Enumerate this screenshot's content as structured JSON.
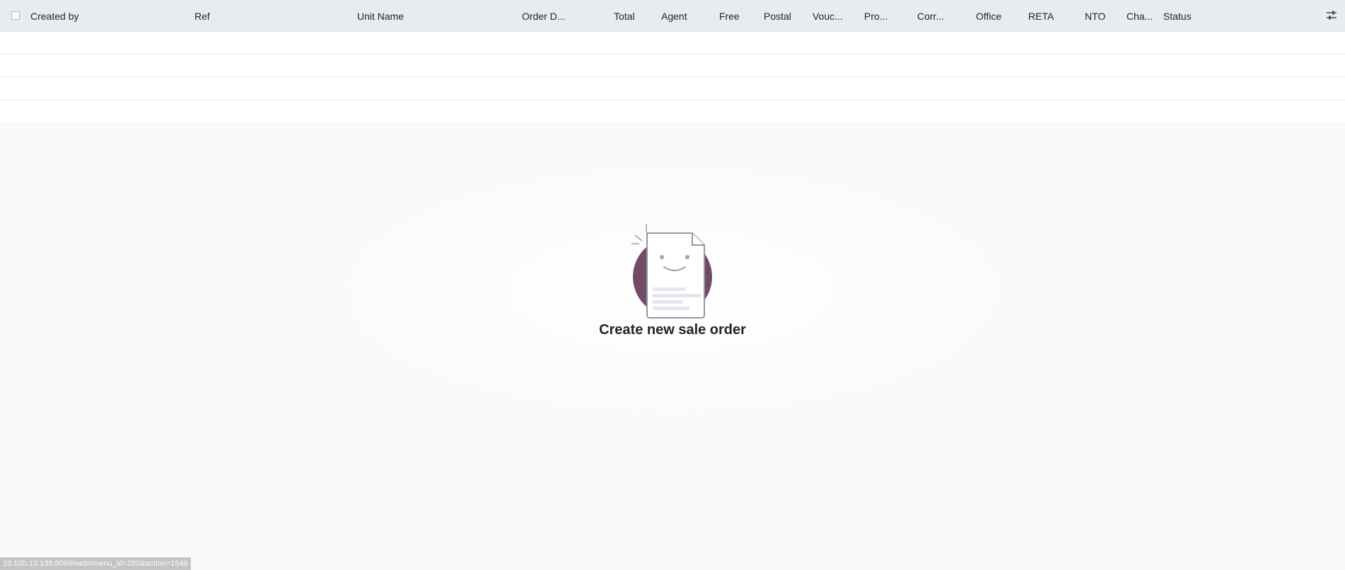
{
  "list": {
    "columns": [
      {
        "key": "created_by",
        "label": "Created by"
      },
      {
        "key": "ref",
        "label": "Ref"
      },
      {
        "key": "unit_name",
        "label": "Unit Name"
      },
      {
        "key": "order_date",
        "label": "Order D..."
      },
      {
        "key": "total",
        "label": "Total"
      },
      {
        "key": "agent",
        "label": "Agent"
      },
      {
        "key": "free",
        "label": "Free"
      },
      {
        "key": "postal",
        "label": "Postal"
      },
      {
        "key": "voucher",
        "label": "Vouc..."
      },
      {
        "key": "pro",
        "label": "Pro..."
      },
      {
        "key": "corr",
        "label": "Corr..."
      },
      {
        "key": "office",
        "label": "Office"
      },
      {
        "key": "reta",
        "label": "RETA"
      },
      {
        "key": "nto",
        "label": "NTO"
      },
      {
        "key": "cha",
        "label": "Cha..."
      },
      {
        "key": "status",
        "label": "Status"
      }
    ],
    "optional_columns_icon": "sliders-icon",
    "select_all_icon": "checkbox-icon"
  },
  "empty_state": {
    "title": "Create new sale order",
    "illustration_icon": "smiling-document-icon",
    "accent_color": "#714B67"
  },
  "status_bar": {
    "url": "10.100.13.138:8069/web#menu_id=280&action=1546"
  }
}
